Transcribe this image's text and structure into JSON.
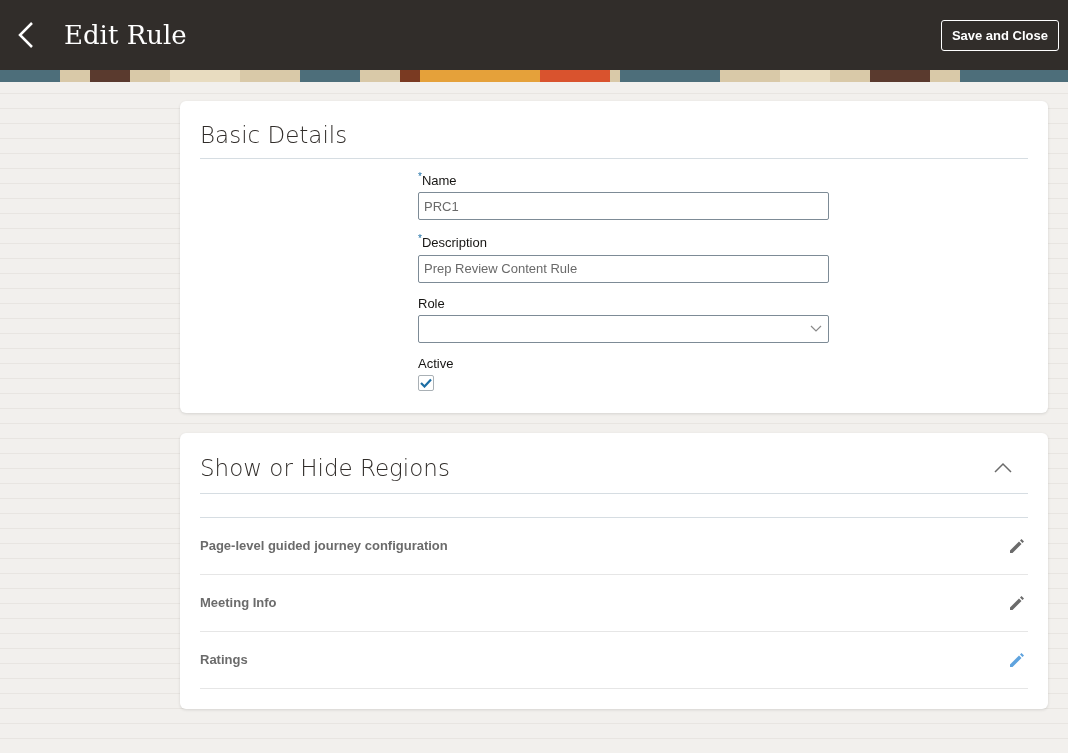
{
  "header": {
    "title": "Edit Rule",
    "button": "Save and Close"
  },
  "basic_details": {
    "title": "Basic Details",
    "fields": [
      {
        "kind": "text",
        "label": "Name",
        "required_mark": "*",
        "value": "PRC1"
      },
      {
        "kind": "text",
        "label": "Description",
        "required_mark": "*",
        "value": "Prep Review Content Rule"
      },
      {
        "kind": "select",
        "label": "Role"
      },
      {
        "kind": "checkbox",
        "label": "Active",
        "checked": true
      }
    ]
  },
  "regions": {
    "title": "Show or Hide Regions",
    "expanded": true,
    "rows": [
      {
        "label": "Page-level guided journey configuration",
        "highlighted": false
      },
      {
        "label": "Meeting Info",
        "highlighted": false
      },
      {
        "label": "Ratings",
        "highlighted": true
      }
    ]
  }
}
